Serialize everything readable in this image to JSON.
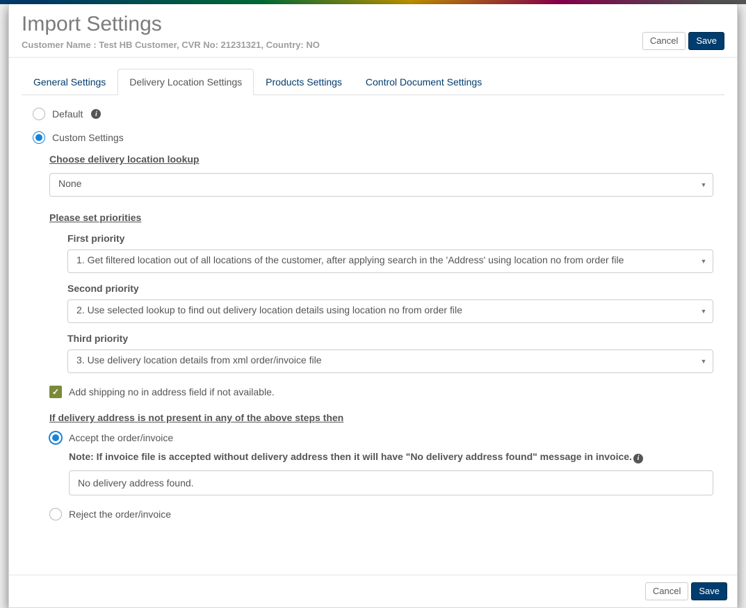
{
  "header": {
    "title": "Import Settings",
    "subtitle": "Customer Name : Test HB Customer, CVR No: 21231321, Country: NO",
    "cancel": "Cancel",
    "save": "Save"
  },
  "tabs": {
    "general": "General Settings",
    "delivery": "Delivery Location Settings",
    "products": "Products Settings",
    "control": "Control Document Settings"
  },
  "settings_mode": {
    "default_label": "Default",
    "custom_label": "Custom Settings"
  },
  "lookup": {
    "heading": "Choose delivery location lookup",
    "selected": "None"
  },
  "priorities": {
    "heading": "Please set priorities",
    "first_label": "First priority",
    "first_value": "1. Get filtered location out of all locations of the customer, after applying search in the 'Address' using location no from order file",
    "second_label": "Second priority",
    "second_value": "2. Use selected lookup to find out delivery location details using location no from order file",
    "third_label": "Third priority",
    "third_value": "3. Use delivery location details from xml order/invoice file"
  },
  "checkbox": {
    "add_shipping": "Add shipping no in address field if not available."
  },
  "fallback": {
    "heading": "If delivery address is not present in any of the above steps then",
    "accept_label": "Accept the order/invoice",
    "note": "Note: If invoice file is accepted without delivery address then it will have \"No delivery address found\" message in invoice.",
    "message_value": "No delivery address found.",
    "reject_label": "Reject the order/invoice"
  },
  "footer": {
    "cancel": "Cancel",
    "save": "Save"
  }
}
